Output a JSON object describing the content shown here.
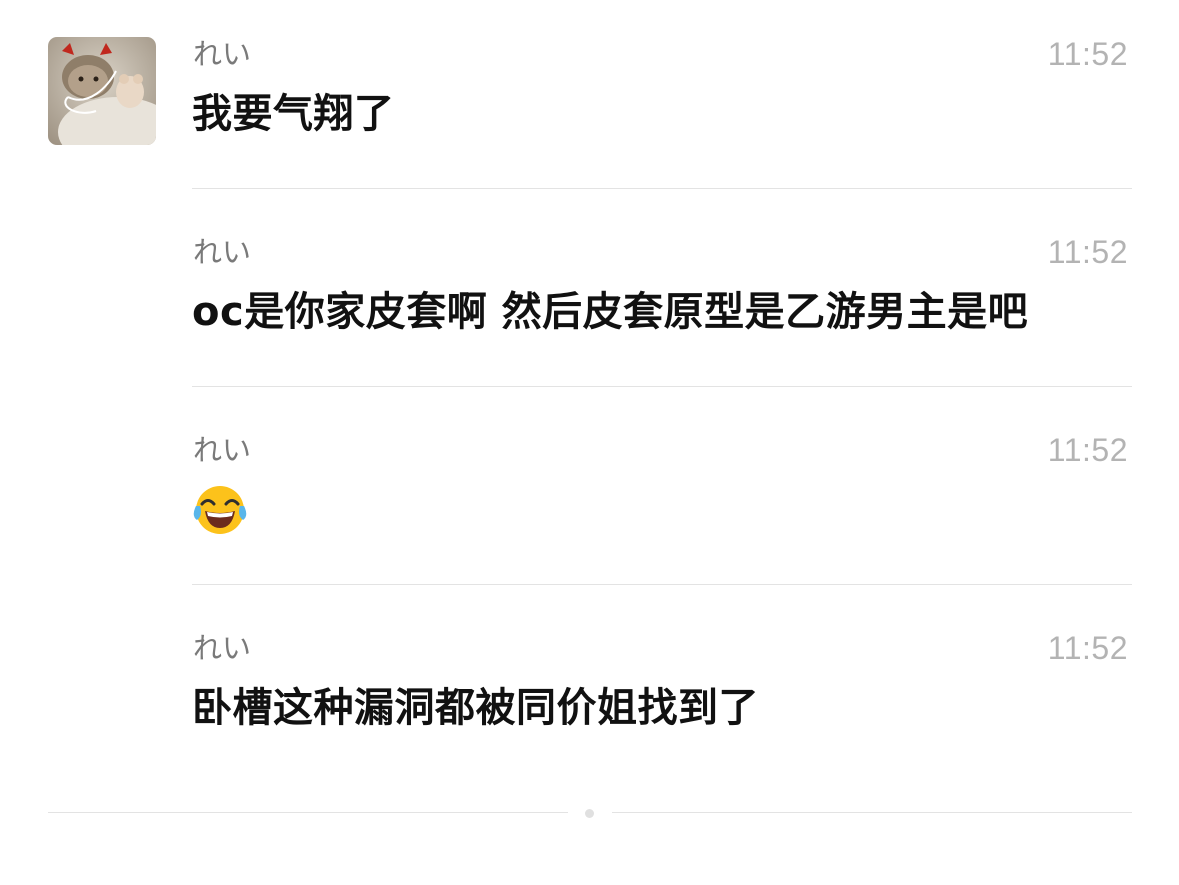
{
  "messages": [
    {
      "sender": "れい",
      "time": "11:52",
      "text": "我要气翔了"
    },
    {
      "sender": "れい",
      "time": "11:52",
      "text": "oc是你家皮套啊 然后皮套原型是乙游男主是吧"
    },
    {
      "sender": "れい",
      "time": "11:52",
      "emoji": "face-with-tears-of-joy-icon"
    },
    {
      "sender": "れい",
      "time": "11:52",
      "text": "卧槽这种漏洞都被同价姐找到了"
    }
  ],
  "colors": {
    "divider": "#e3e3e3",
    "timestamp": "#b3b3b3",
    "sender": "#7a7a7a",
    "text": "#111111"
  }
}
